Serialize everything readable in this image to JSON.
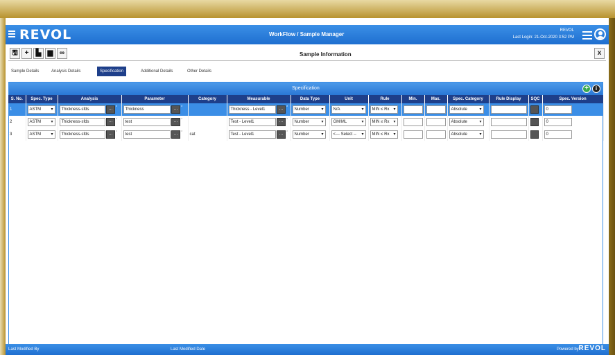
{
  "app": {
    "logo": "REVOL",
    "header_title": "WorkFlow / Sample Manager",
    "user": "REVOL",
    "last_login": "Last Login: 21-Oct-2020 3:52 PM"
  },
  "toolbar": {
    "title": "Sample Information",
    "close_label": "x",
    "buttons": [
      "save-icon",
      "add-icon",
      "factory-icon",
      "print-icon",
      "binoculars-icon"
    ]
  },
  "tabs": [
    {
      "label": "Sample Details"
    },
    {
      "label": "Analysis Details"
    },
    {
      "label": "Specification",
      "active": true
    },
    {
      "label": "Additional Details"
    },
    {
      "label": "Other Details"
    }
  ],
  "panel": {
    "title": "Specification"
  },
  "columns": [
    "S. No.",
    "Spec. Type",
    "Analysis",
    "Parameter",
    "Category",
    "Measurable",
    "Data Type",
    "Unit",
    "Rule",
    "Min.",
    "Max.",
    "Spec. Category",
    "Rule Display",
    "SQC",
    "Spec. Version"
  ],
  "rows": [
    {
      "sno": "1",
      "spec_type": "ASTM",
      "analysis": "Thickness-sfds",
      "parameter": "Thickness",
      "category": "",
      "measurable": "Thickness - Level1",
      "data_type": "Number",
      "unit": "N/A",
      "rule": "MIN ≤ Rx",
      "min": "",
      "max": "",
      "spec_category": "Absolute",
      "rule_display": "",
      "spec_version": "0"
    },
    {
      "sno": "2",
      "spec_type": "ASTM",
      "analysis": "Thickness-sfds",
      "parameter": "test",
      "category": "",
      "measurable": "Test - Level1",
      "data_type": "Number",
      "unit": "GM/ML",
      "rule": "MIN ≤ Rx",
      "min": "",
      "max": "",
      "spec_category": "Absolute",
      "rule_display": "",
      "spec_version": "0"
    },
    {
      "sno": "3",
      "spec_type": "ASTM",
      "analysis": "Thickness-sfds",
      "parameter": "test",
      "category": "cat",
      "measurable": "Test - Level1",
      "data_type": "Number",
      "unit": "<--- Select --",
      "rule": "MIN ≤ Rx",
      "min": "",
      "max": "",
      "spec_category": "Absolute",
      "rule_display": "",
      "spec_version": "0"
    }
  ],
  "footer": {
    "last_modified_by": "Last Modified By",
    "last_modified_date": "Last Modified Date",
    "powered_by": "Powered by :",
    "logo": "REVOL"
  },
  "colors": {
    "header_blue": "#2a78d6",
    "tab_active": "#1e3f8a",
    "gold": "#b8922e"
  }
}
